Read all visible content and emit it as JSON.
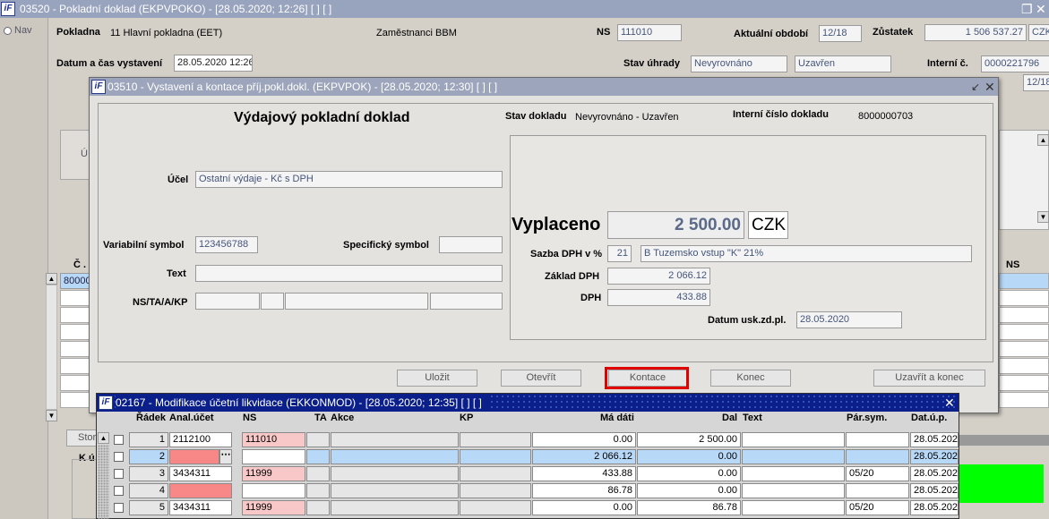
{
  "main": {
    "title": "03520 - Pokladní doklad (EKPVPOKO) - [28.05.2020; 12:26] [ ] [ ]",
    "nav_label": "Nav",
    "pokladna_label": "Pokladna",
    "pokladna_value": "11 Hlavní pokladna (EET)",
    "zamestnanci": "Zaměstnanci BBM",
    "ns_label": "NS",
    "ns_value": "111010",
    "obdobi_label": "Aktuální období",
    "obdobi_value": "12/18",
    "zustatek_label": "Zůstatek",
    "zustatek_value": "1 506 537.27",
    "zustatek_currency": "CZK",
    "datum_label": "Datum a čas vystavení",
    "datum_value": "28.05.2020 12:26",
    "stav_uhrady_label": "Stav úhrady",
    "stav_uhrady_1": "Nevyrovnáno",
    "stav_uhrady_2": "Uzavřen",
    "interni_label": "Interní č.",
    "interni_value": "0000221796",
    "obdobi2_value": "12/18",
    "side_letter": "Ú",
    "grid_col_c": "Č .",
    "grid_row_value": "80000",
    "grid_col_ns": "NS",
    "stor_button": "Stor",
    "k_label": "K ú"
  },
  "dialog1": {
    "title": "03510 - Vystavení a kontace příj.pokl.dokl. (EKPVPOK) - [28.05.2020; 12:30] [ ] [ ]",
    "heading": "Výdajový pokladní doklad",
    "stav_label": "Stav dokladu",
    "stav_value": "Nevyrovnáno - Uzavřen",
    "interni_label": "Interní číslo dokladu",
    "interni_value": "8000000703",
    "ucel_label": "Účel",
    "ucel_value": "Ostatní výdaje - Kč s DPH",
    "vs_label": "Variabilní symbol",
    "vs_value": "123456788",
    "ss_label": "Specifický symbol",
    "ss_value": "",
    "text_label": "Text",
    "text_value": "",
    "ns_label": "NS/TA/A/KP",
    "vyplaceno_label": "Vyplaceno",
    "vyplaceno_value": "2 500.00",
    "currency": "CZK",
    "sazba_label": "Sazba DPH v %",
    "sazba_value": "21",
    "sazba_desc": "B  Tuzemsko vstup \"K\" 21%",
    "zaklad_label": "Základ DPH",
    "zaklad_value": "2 066.12",
    "dph_label": "DPH",
    "dph_value": "433.88",
    "datum_usk_label": "Datum usk.zd.pl.",
    "datum_usk_value": "28.05.2020",
    "buttons": {
      "ulozit": "Uložit",
      "otevrit": "Otevřít",
      "kontace": "Kontace",
      "konec": "Konec",
      "uzavrit": "Uzavřít a konec"
    }
  },
  "dialog2": {
    "title": "02167 - Modifikace účetní likvidace (EKKONMOD) - [28.05.2020; 12:35] [ ] [ ]",
    "columns": {
      "radek": "Řádek",
      "anal": "Anal.účet",
      "ns": "NS",
      "ta": "TA",
      "akce": "Akce",
      "kp": "KP",
      "madati": "Má dáti",
      "dal": "Dal",
      "text": "Text",
      "parsym": "Pár.sym.",
      "datup": "Dat.ú.p."
    },
    "rows": [
      {
        "radek": "1",
        "anal": "2112100",
        "ns": "111010",
        "madati": "0.00",
        "dal": "2 500.00",
        "parsym": "",
        "datup": "28.05.202"
      },
      {
        "radek": "2",
        "anal": "",
        "ns": "",
        "madati": "2 066.12",
        "dal": "0.00",
        "parsym": "",
        "datup": "28.05.202"
      },
      {
        "radek": "3",
        "anal": "3434311",
        "ns": "11999",
        "madati": "433.88",
        "dal": "0.00",
        "parsym": "05/20",
        "datup": "28.05.202"
      },
      {
        "radek": "4",
        "anal": "",
        "ns": "",
        "madati": "86.78",
        "dal": "0.00",
        "parsym": "",
        "datup": "28.05.202"
      },
      {
        "radek": "5",
        "anal": "3434311",
        "ns": "11999",
        "madati": "0.00",
        "dal": "86.78",
        "parsym": "05/20",
        "datup": "28.05.202"
      }
    ]
  }
}
